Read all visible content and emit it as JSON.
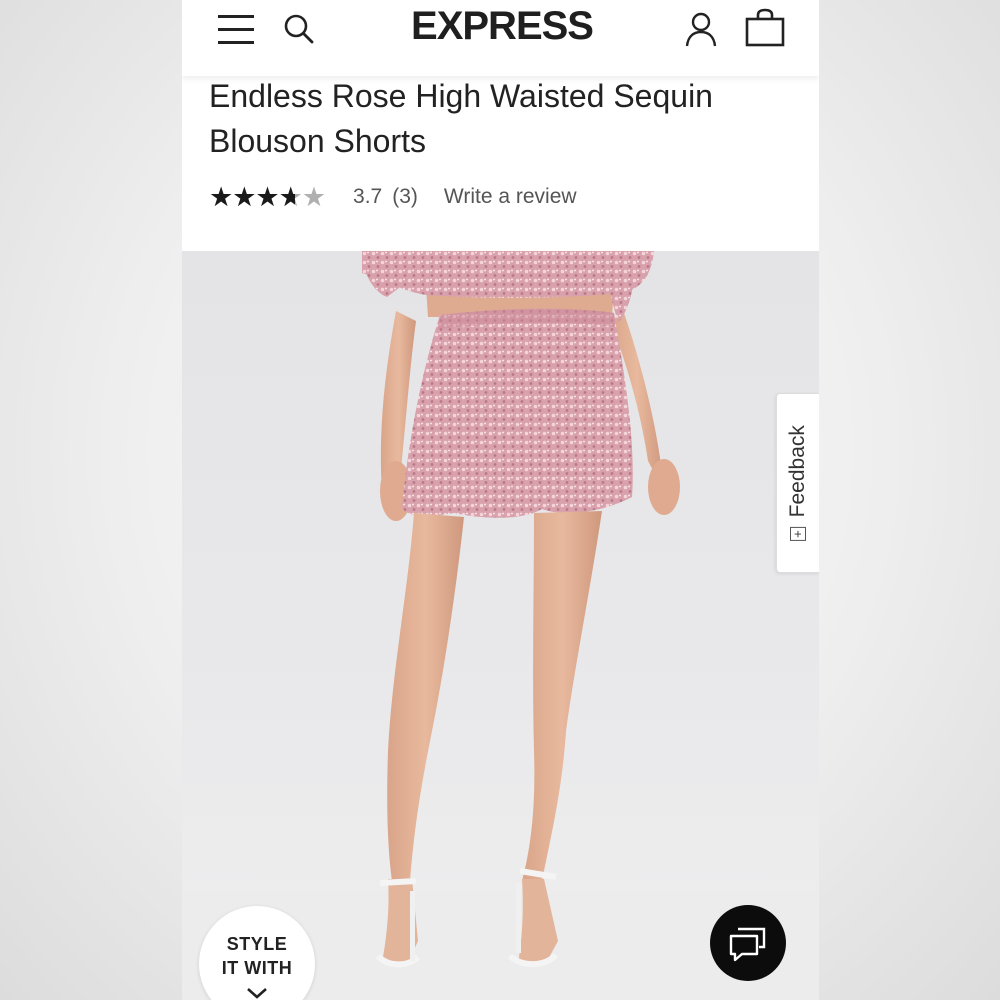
{
  "header": {
    "brand": "EXPRESS",
    "menu_icon": "hamburger-menu-icon",
    "search_icon": "search-icon",
    "account_icon": "account-icon",
    "bag_icon": "shopping-bag-icon"
  },
  "product": {
    "title": "Endless Rose High Waisted Sequin Blouson Shorts",
    "rating": {
      "stars_full": "★★★★★",
      "stars_empty": "★★★★★",
      "value": "3.7",
      "count": "(3)",
      "out_of": 5,
      "write_review_label": "Write a review"
    },
    "image_icon": "product-photo"
  },
  "feedback": {
    "label": "Feedback",
    "icon_glyph": "+"
  },
  "style_it_with": {
    "line1": "STYLE",
    "line2": "IT WITH"
  },
  "chat": {
    "icon": "chat-bubbles-icon"
  },
  "colors": {
    "text": "#222222",
    "sequin_pink": "#d9a3ad",
    "chat_bg": "#0c0c0c"
  }
}
